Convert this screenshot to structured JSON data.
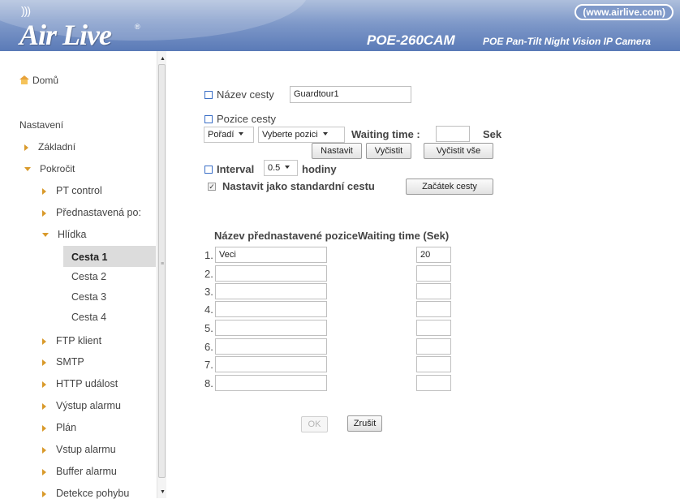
{
  "header": {
    "logo": "Air Live",
    "site_link": "(www.airlive.com)",
    "model": "POE-260CAM",
    "model_desc": "POE Pan-Tilt Night Vision IP Camera"
  },
  "sidebar": {
    "home": "Domů",
    "section": "Nastavení",
    "items": {
      "basic": "Základní",
      "advanced": "Pokročit",
      "pt_control": "PT control",
      "preset": "Přednastavená po:",
      "guard": "Hlídka",
      "route1": "Cesta 1",
      "route2": "Cesta 2",
      "route3": "Cesta 3",
      "route4": "Cesta 4",
      "ftp": "FTP klient",
      "smtp": "SMTP",
      "http": "HTTP událost",
      "alarm_out": "Výstup alarmu",
      "schedule": "Plán",
      "alarm_in": "Vstup alarmu",
      "alarm_buffer": "Buffer alarmu",
      "motion": "Detekce pohybu"
    }
  },
  "form": {
    "route_name_label": "Název cesty",
    "route_name_value": "Guardtour1",
    "route_position_label": "Pozice cesty",
    "order_select": "Pořadí",
    "position_select": "Vyberte pozici",
    "waiting_label": "Waiting time :",
    "waiting_value": "",
    "sec_label": "Sek",
    "btn_set": "Nastavit",
    "btn_clear": "Vyčistit",
    "btn_clear_all": "Vyčistit vše",
    "interval_label": "Interval",
    "interval_value": "0.5",
    "hours_label": "hodiny",
    "default_label": "Nastavit jako standardní cestu",
    "default_checked": true,
    "btn_start": "Začátek cesty",
    "table_header": "Název přednastavené poziceWaiting time (Sek)",
    "rows": [
      {
        "num": "1.",
        "name": "Veci",
        "time": "20"
      },
      {
        "num": "2.",
        "name": "",
        "time": ""
      },
      {
        "num": "3.",
        "name": "",
        "time": ""
      },
      {
        "num": "4.",
        "name": "",
        "time": ""
      },
      {
        "num": "5.",
        "name": "",
        "time": ""
      },
      {
        "num": "6.",
        "name": "",
        "time": ""
      },
      {
        "num": "7.",
        "name": "",
        "time": ""
      },
      {
        "num": "8.",
        "name": "",
        "time": ""
      }
    ],
    "btn_ok": "OK",
    "btn_cancel": "Zrušit"
  }
}
